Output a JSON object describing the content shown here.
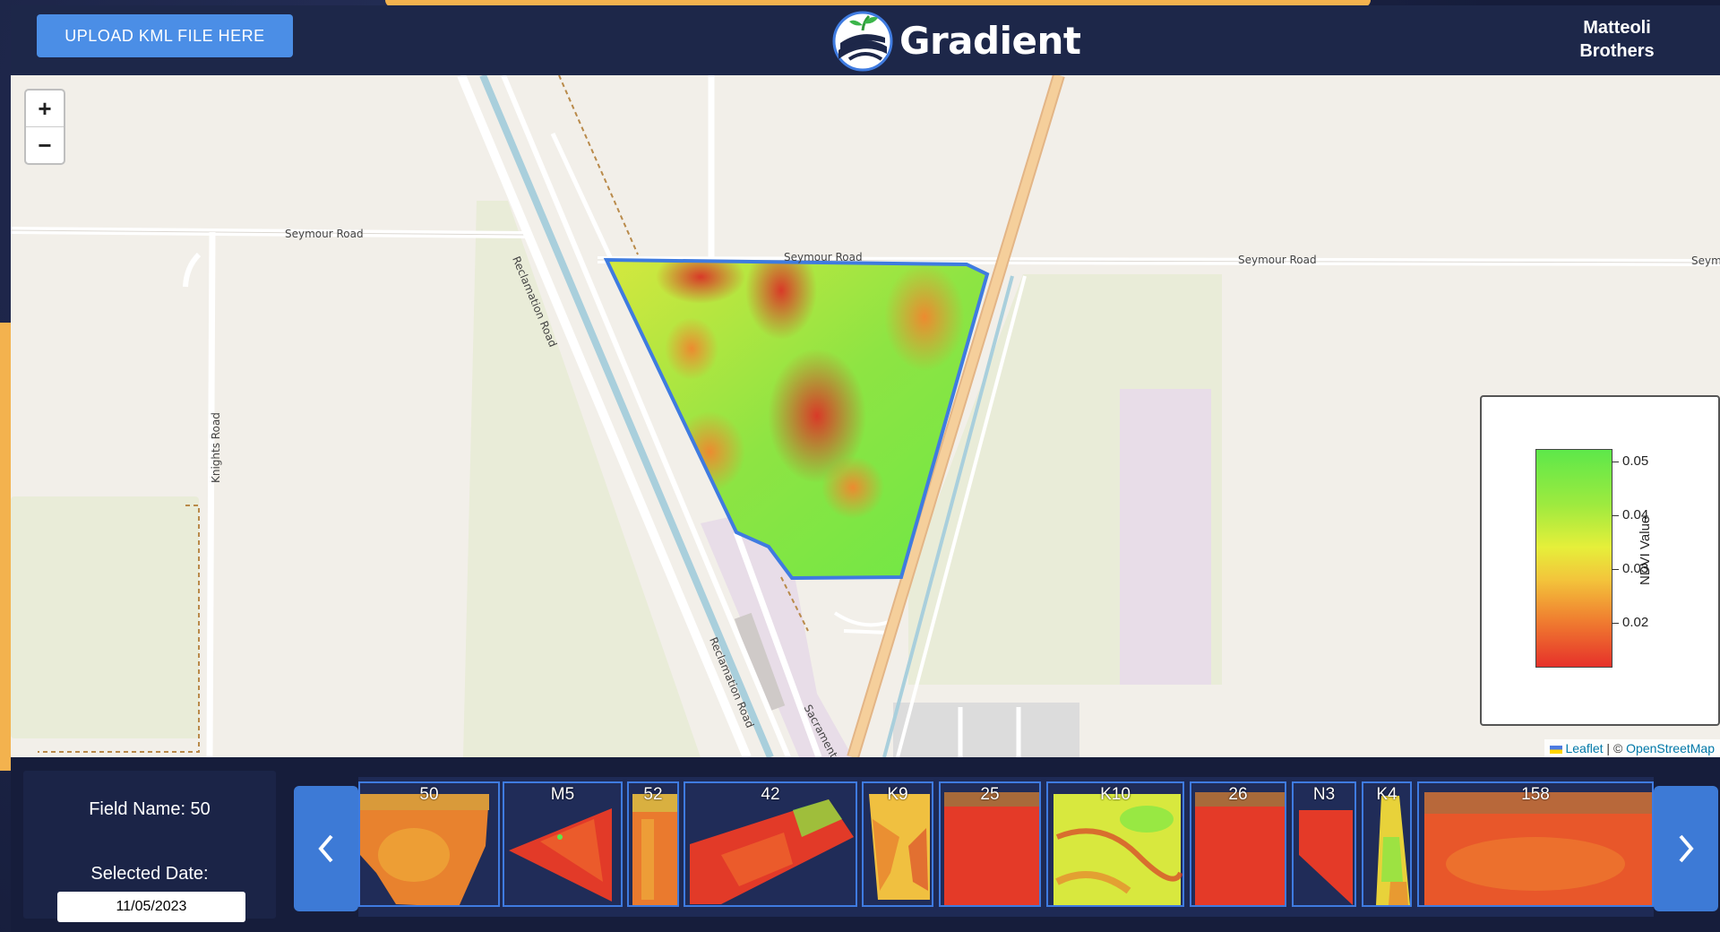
{
  "header": {
    "upload_button": "UPLOAD KML FILE HERE",
    "brand_name": "Gradient",
    "user_name": "Matteoli Brothers"
  },
  "map": {
    "zoom_in": "+",
    "zoom_out": "−",
    "road_labels": {
      "seymour_1": "Seymour Road",
      "seymour_2": "Seymour Road",
      "seymour_3": "Seymour Road",
      "seymour_4": "Seym",
      "reclamation_1": "Reclamation Road",
      "reclamation_2": "Reclamation Road",
      "knights": "Knights Road",
      "sacramento": "Sacramento"
    },
    "legend": {
      "axis_label": "NDVI Value",
      "ticks": [
        "0.05",
        "0.04",
        "0.03",
        "0.02"
      ],
      "colors": [
        "#5de84a",
        "#e6ef3a",
        "#f08030",
        "#e6312a"
      ]
    },
    "attribution": {
      "leaflet": "Leaflet",
      "separator": " | © ",
      "osm": "OpenStreetMap"
    }
  },
  "info_panel": {
    "field_name": "Field Name: 50",
    "date_label": "Selected Date:",
    "date_value": "11/05/2023"
  },
  "carousel": {
    "prev_icon": "chevron-left-icon",
    "next_icon": "chevron-right-icon",
    "fields": [
      "50",
      "M5",
      "52",
      "42",
      "K9",
      "25",
      "K10",
      "26",
      "N3",
      "K4",
      "158"
    ]
  },
  "colors": {
    "header_bg": "#1d2749",
    "accent_blue": "#4b8ee6",
    "field_outline": "#3f7be0",
    "ndvi_high": "#5de84a",
    "ndvi_low": "#e6312a"
  }
}
